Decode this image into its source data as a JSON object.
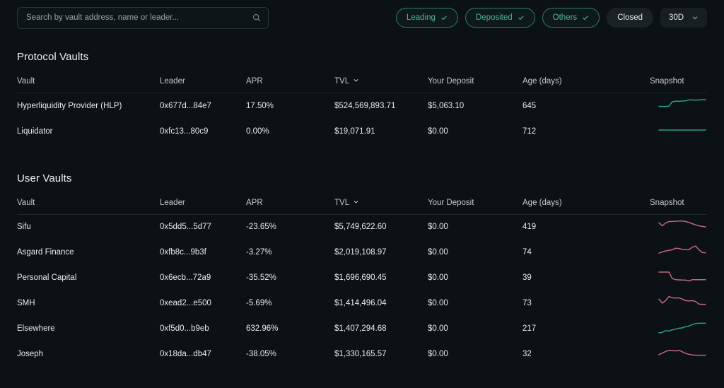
{
  "search": {
    "placeholder": "Search by vault address, name or leader...",
    "value": "",
    "icon": "search-icon"
  },
  "filters": [
    {
      "label": "Leading",
      "style": "outline",
      "icon": "check-icon"
    },
    {
      "label": "Deposited",
      "style": "outline",
      "icon": "check-icon"
    },
    {
      "label": "Others",
      "style": "outline",
      "icon": "check-icon"
    },
    {
      "label": "Closed",
      "style": "solid",
      "icon": ""
    }
  ],
  "range_selector": {
    "label": "30D",
    "icon": "chevron-down-icon"
  },
  "columns": [
    {
      "key": "vault",
      "label": "Vault",
      "sortable": false
    },
    {
      "key": "leader",
      "label": "Leader",
      "sortable": false
    },
    {
      "key": "apr",
      "label": "APR",
      "sortable": false
    },
    {
      "key": "tvl",
      "label": "TVL",
      "sortable": true
    },
    {
      "key": "deposit",
      "label": "Your Deposit",
      "sortable": false
    },
    {
      "key": "age",
      "label": "Age (days)",
      "sortable": false
    },
    {
      "key": "snap",
      "label": "Snapshot",
      "sortable": false
    }
  ],
  "colors": {
    "positive": "#3aa17f",
    "negative": "#d0607a",
    "accent": "#4fb397",
    "background": "#0b1114",
    "border": "#1d2629"
  },
  "protocol_vaults": {
    "title": "Protocol Vaults",
    "rows": [
      {
        "vault": "Hyperliquidity Provider (HLP)",
        "leader": "0x677d...84e7",
        "apr": "17.50%",
        "apr_sign": "positive",
        "tvl": "$524,569,893.71",
        "deposit": "$5,063.10",
        "age": "645",
        "spark_color": "#2e9e8c",
        "spark_points": [
          0.38,
          0.38,
          0.38,
          0.4,
          0.68,
          0.72,
          0.72,
          0.73,
          0.74,
          0.8,
          0.8,
          0.78,
          0.8,
          0.82,
          0.82
        ]
      },
      {
        "vault": "Liquidator",
        "leader": "0xfc13...80c9",
        "apr": "0.00%",
        "apr_sign": "neutral",
        "tvl": "$19,071.91",
        "deposit": "$0.00",
        "age": "712",
        "spark_color": "#2e9e8c",
        "spark_points": [
          0.5,
          0.5,
          0.5,
          0.5,
          0.5,
          0.5,
          0.5,
          0.5,
          0.5,
          0.5,
          0.5,
          0.5,
          0.5,
          0.5,
          0.5
        ]
      }
    ]
  },
  "user_vaults": {
    "title": "User Vaults",
    "rows": [
      {
        "vault": "Sifu",
        "leader": "0x5dd5...5d77",
        "apr": "-23.65%",
        "apr_sign": "negative",
        "tvl": "$5,749,622.60",
        "deposit": "$0.00",
        "age": "419",
        "spark_color": "#c4667d",
        "spark_points": [
          0.72,
          0.52,
          0.7,
          0.8,
          0.8,
          0.82,
          0.83,
          0.83,
          0.8,
          0.74,
          0.66,
          0.58,
          0.52,
          0.48,
          0.45
        ]
      },
      {
        "vault": "Asgard Finance",
        "leader": "0xfb8c...9b3f",
        "apr": "-3.27%",
        "apr_sign": "negative",
        "tvl": "$2,019,108.97",
        "deposit": "$0.00",
        "age": "74",
        "spark_color": "#c4667d",
        "spark_points": [
          0.4,
          0.48,
          0.54,
          0.58,
          0.62,
          0.72,
          0.7,
          0.64,
          0.62,
          0.62,
          0.78,
          0.86,
          0.62,
          0.44,
          0.42
        ]
      },
      {
        "vault": "Personal Capital",
        "leader": "0x6ecb...72a9",
        "apr": "-35.52%",
        "apr_sign": "negative",
        "tvl": "$1,696,690.45",
        "deposit": "$0.00",
        "age": "39",
        "spark_color": "#c4667d",
        "spark_points": [
          0.82,
          0.82,
          0.82,
          0.82,
          0.4,
          0.33,
          0.32,
          0.31,
          0.3,
          0.25,
          0.33,
          0.33,
          0.33,
          0.33,
          0.33
        ]
      },
      {
        "vault": "SMH",
        "leader": "0xead2...e500",
        "apr": "-5.69%",
        "apr_sign": "negative",
        "tvl": "$1,414,496.04",
        "deposit": "$0.00",
        "age": "73",
        "spark_color": "#c4667d",
        "spark_points": [
          0.72,
          0.46,
          0.62,
          0.88,
          0.8,
          0.78,
          0.8,
          0.72,
          0.62,
          0.6,
          0.62,
          0.56,
          0.4,
          0.38,
          0.38
        ]
      },
      {
        "vault": "Elsewhere",
        "leader": "0xf5d0...b9eb",
        "apr": "632.96%",
        "apr_sign": "positive",
        "tvl": "$1,407,294.68",
        "deposit": "$0.00",
        "age": "217",
        "spark_color": "#2e9e8c",
        "spark_points": [
          0.18,
          0.22,
          0.32,
          0.3,
          0.38,
          0.42,
          0.48,
          0.5,
          0.58,
          0.62,
          0.72,
          0.78,
          0.8,
          0.8,
          0.8
        ]
      },
      {
        "vault": "Joseph",
        "leader": "0x18da...db47",
        "apr": "-38.05%",
        "apr_sign": "negative",
        "tvl": "$1,330,165.57",
        "deposit": "$0.00",
        "age": "32",
        "spark_color": "#c4667d",
        "spark_points": [
          0.42,
          0.52,
          0.62,
          0.7,
          0.68,
          0.66,
          0.7,
          0.6,
          0.5,
          0.44,
          0.4,
          0.38,
          0.38,
          0.38,
          0.38
        ]
      }
    ]
  }
}
